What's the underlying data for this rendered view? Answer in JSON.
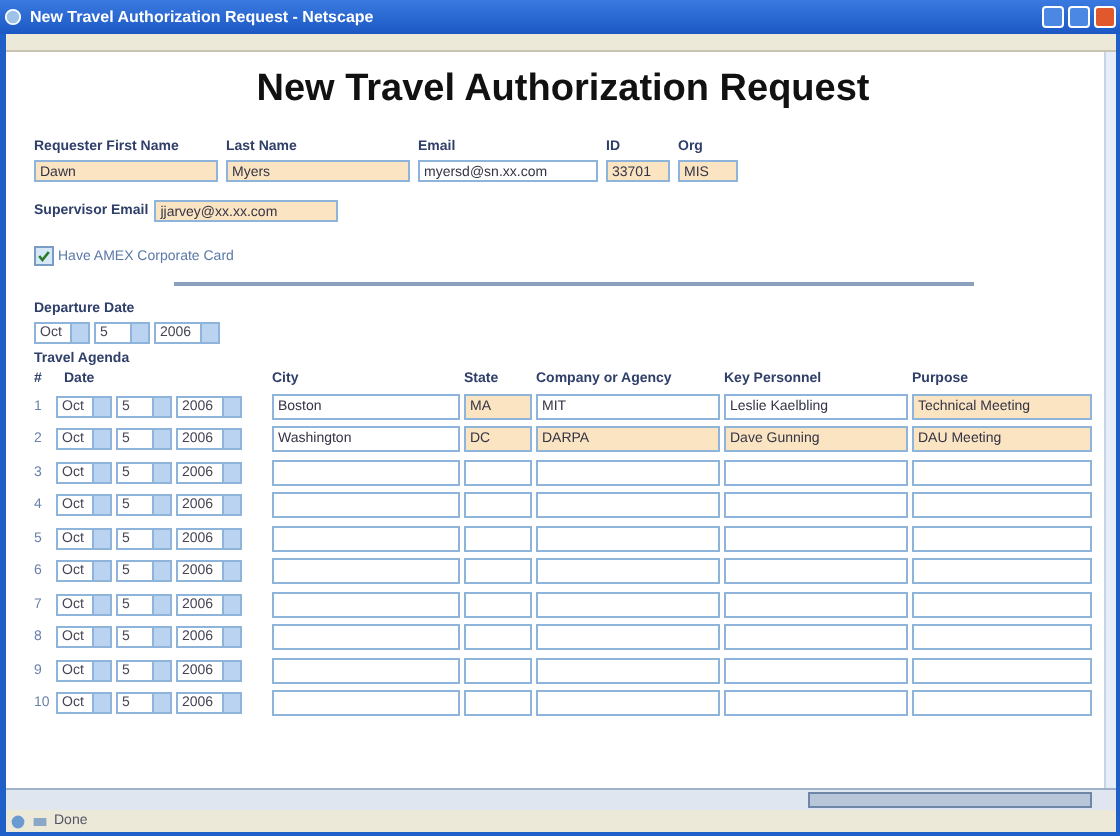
{
  "window": {
    "title": "New Travel Authorization Request - Netscape"
  },
  "heading": "New Travel Authorization Request",
  "requester_fields": [
    {
      "label": "Requester First Name",
      "value": "Dawn",
      "highlighted": true
    },
    {
      "label": "Last Name",
      "value": "Myers",
      "highlighted": true
    },
    {
      "label": "Email",
      "value": "myersd@sn.xx.com",
      "highlighted": false
    },
    {
      "label": "ID",
      "value": "33701",
      "highlighted": true
    },
    {
      "label": "Org",
      "value": "MIS",
      "highlighted": true
    }
  ],
  "supervisor": {
    "label": "Supervisor Email",
    "value": "jjarvey@xx.xx.com",
    "highlighted": true
  },
  "amex": {
    "label": "Have AMEX Corporate Card",
    "checked": true
  },
  "departure": {
    "label": "Departure Date",
    "month": "Oct",
    "day": "5",
    "year": "2006"
  },
  "agenda": {
    "title": "Travel Agenda",
    "columns": [
      "#",
      "Date",
      "City",
      "State",
      "Company or Agency",
      "Key Personnel",
      "Purpose"
    ],
    "rows": [
      {
        "number": "1",
        "month": "Oct",
        "day": "5",
        "year": "2006",
        "city": {
          "value": "Boston",
          "highlighted": false
        },
        "state": {
          "value": "MA",
          "highlighted": true
        },
        "company": {
          "value": "MIT",
          "highlighted": false
        },
        "personnel": {
          "value": "Leslie Kaelbling",
          "highlighted": false
        },
        "purpose": {
          "value": "Technical Meeting",
          "highlighted": true
        }
      },
      {
        "number": "2",
        "month": "Oct",
        "day": "5",
        "year": "2006",
        "city": {
          "value": "Washington",
          "highlighted": false
        },
        "state": {
          "value": "DC",
          "highlighted": true
        },
        "company": {
          "value": "DARPA",
          "highlighted": true
        },
        "personnel": {
          "value": "Dave Gunning",
          "highlighted": true
        },
        "purpose": {
          "value": "DAU Meeting",
          "highlighted": true
        }
      },
      {
        "number": "3",
        "month": "Oct",
        "day": "5",
        "year": "2006"
      },
      {
        "number": "4",
        "month": "Oct",
        "day": "5",
        "year": "2006"
      },
      {
        "number": "5",
        "month": "Oct",
        "day": "5",
        "year": "2006"
      },
      {
        "number": "6",
        "month": "Oct",
        "day": "5",
        "year": "2006"
      },
      {
        "number": "7",
        "month": "Oct",
        "day": "5",
        "year": "2006"
      },
      {
        "number": "8",
        "month": "Oct",
        "day": "5",
        "year": "2006"
      },
      {
        "number": "9",
        "month": "Oct",
        "day": "5",
        "year": "2006"
      },
      {
        "number": "10",
        "month": "Oct",
        "day": "5",
        "year": "2006"
      }
    ]
  },
  "status_bar": {
    "text": "Done"
  }
}
